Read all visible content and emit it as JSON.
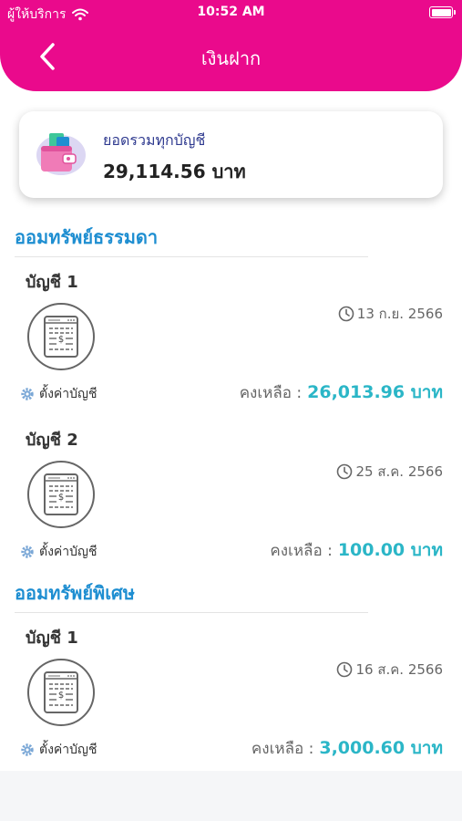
{
  "status_bar": {
    "carrier": "ผู้ให้บริการ",
    "time": "10:52 AM"
  },
  "header": {
    "title": "เงินฝาก"
  },
  "summary": {
    "label": "ยอดรวมทุกบัญชี",
    "value": "29,114.56 บาท"
  },
  "sections": [
    {
      "title": "ออมทรัพย์ธรรมดา",
      "accounts": [
        {
          "name": "บัญชี 1",
          "date": "13 ก.ย. 2566",
          "settings_label": "ตั้งค่าบัญชี",
          "balance_label": "คงเหลือ :",
          "balance": "26,013.96 บาท"
        },
        {
          "name": "บัญชี 2",
          "date": "25 ส.ค. 2566",
          "settings_label": "ตั้งค่าบัญชี",
          "balance_label": "คงเหลือ :",
          "balance": "100.00 บาท"
        }
      ]
    },
    {
      "title": "ออมทรัพย์พิเศษ",
      "accounts": [
        {
          "name": "บัญชี 1",
          "date": "16 ส.ค. 2566",
          "settings_label": "ตั้งค่าบัญชี",
          "balance_label": "คงเหลือ :",
          "balance": "3,000.60 บาท"
        }
      ]
    }
  ],
  "icons": {
    "wifi": "wifi-icon",
    "battery": "battery-icon",
    "back": "chevron-left-icon",
    "wallet": "wallet-icon",
    "account": "account-book-icon",
    "clock": "clock-icon",
    "gear": "gear-icon"
  },
  "colors": {
    "header": "#ea0a8c",
    "section_title": "#1e8ed1",
    "balance": "#2bb6c7",
    "summary_label": "#2f3a8f"
  }
}
